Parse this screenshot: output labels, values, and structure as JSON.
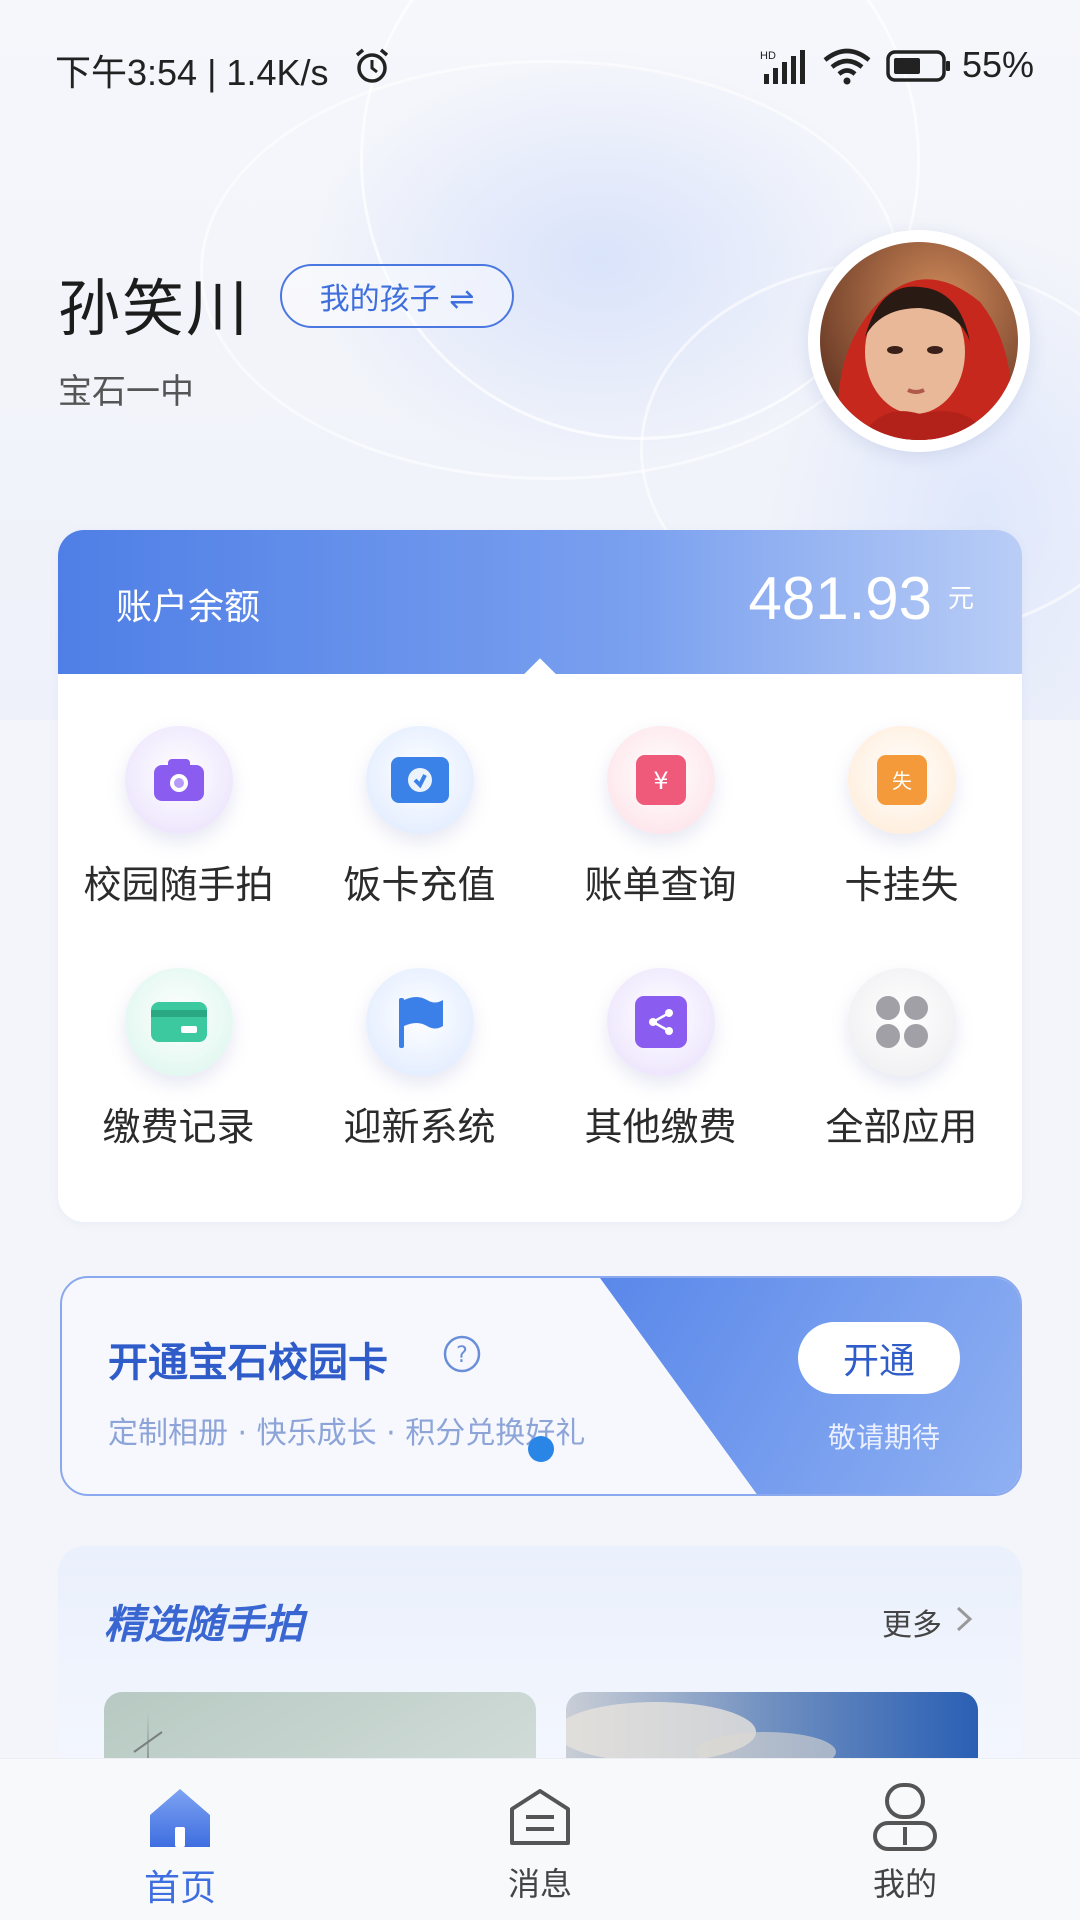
{
  "status_bar": {
    "time": "下午3:54 | 1.4K/s",
    "battery": "55%"
  },
  "profile": {
    "name": "孙笑川",
    "switch_label": "我的孩子 ⇌",
    "school": "宝石一中"
  },
  "balance": {
    "label": "账户余额",
    "amount": "481.93",
    "unit": "元"
  },
  "apps": [
    {
      "label": "校园随手拍",
      "icon": "camera-icon",
      "color": "#8a5cf0"
    },
    {
      "label": "饭卡充值",
      "icon": "card-recharge-icon",
      "color": "#3b82e8"
    },
    {
      "label": "账单查询",
      "icon": "bill-icon",
      "color": "#ef5a7a"
    },
    {
      "label": "卡挂失",
      "icon": "card-loss-icon",
      "color": "#f59a3a"
    },
    {
      "label": "缴费记录",
      "icon": "payment-record-icon",
      "color": "#3cc9a0"
    },
    {
      "label": "迎新系统",
      "icon": "flag-icon",
      "color": "#3b7fe8"
    },
    {
      "label": "其他缴费",
      "icon": "share-icon",
      "color": "#8a5cf0"
    },
    {
      "label": "全部应用",
      "icon": "all-apps-icon",
      "color": "#9a9aa0"
    }
  ],
  "banner": {
    "title": "开通宝石校园卡",
    "subtitle": "定制相册 · 快乐成长 · 积分兑换好礼",
    "button": "开通",
    "note": "敬请期待"
  },
  "featured": {
    "title": "精选随手拍",
    "more": "更多"
  },
  "tabs": [
    {
      "label": "首页",
      "icon": "home-icon",
      "active": true
    },
    {
      "label": "消息",
      "icon": "message-icon",
      "active": false
    },
    {
      "label": "我的",
      "icon": "profile-icon",
      "active": false
    }
  ],
  "colors": {
    "accent": "#3e6ee0",
    "balance_gradient_start": "#4f7fe6",
    "pager_dot": "#2a86e6"
  }
}
